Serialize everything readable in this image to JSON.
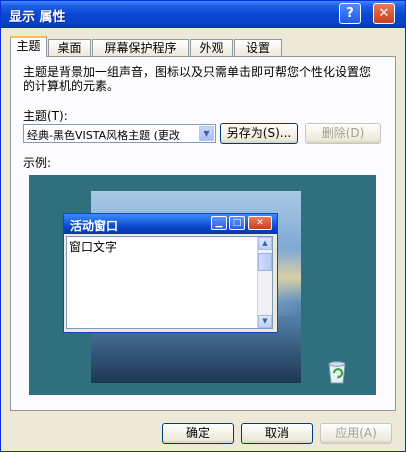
{
  "window": {
    "title": "显示 属性",
    "help_label": "?",
    "close_label": "✕"
  },
  "tabs": [
    {
      "label": "主题",
      "active": true
    },
    {
      "label": "桌面",
      "active": false
    },
    {
      "label": "屏幕保护程序",
      "active": false
    },
    {
      "label": "外观",
      "active": false
    },
    {
      "label": "设置",
      "active": false
    }
  ],
  "theme": {
    "description": "主题是背景加一组声音，图标以及只需单击即可帮您个性化设置您的计算机的元素。",
    "label": "主题(T):",
    "selected_value": "经典-黑色VISTA风格主题 (更改",
    "save_as_label": "另存为(S)...",
    "delete_label": "删除(D)"
  },
  "sample": {
    "label": "示例:",
    "active_window_title": "活动窗口",
    "window_text": "窗口文字"
  },
  "footer": {
    "ok_label": "确定",
    "cancel_label": "取消",
    "apply_label": "应用(A)"
  },
  "icons": [
    "help-icon",
    "close-icon",
    "dropdown-arrow-icon",
    "minimize-icon",
    "maximize-icon",
    "recycle-bin-icon"
  ],
  "colors": {
    "titlebar": "#0842c6",
    "preview_background": "#2f6f7e"
  }
}
